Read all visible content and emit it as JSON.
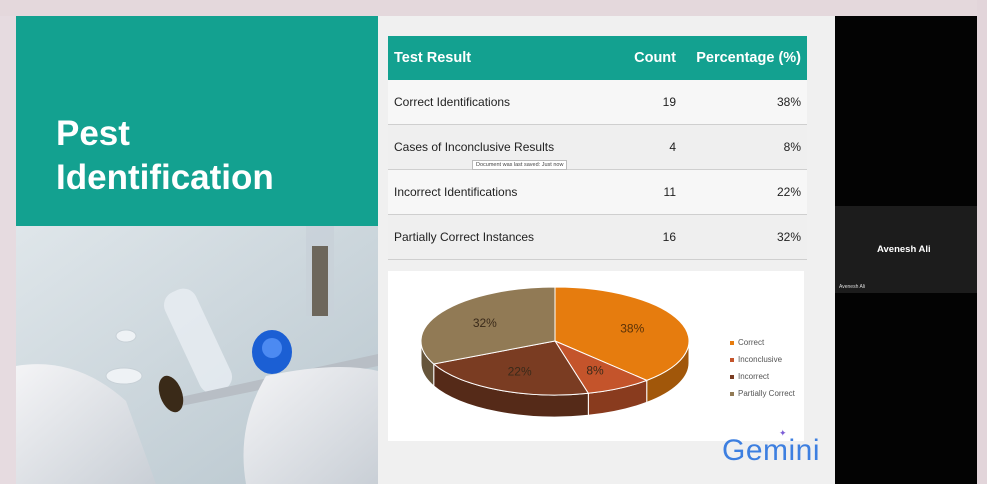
{
  "slide": {
    "title": "Pest Identification",
    "table": {
      "headers": [
        "Test Result",
        "Count",
        "Percentage (%)"
      ],
      "rows": [
        {
          "label": "Correct Identifications",
          "count": "19",
          "percent": "38%"
        },
        {
          "label": "Cases of Inconclusive Results",
          "count": "4",
          "percent": "8%"
        },
        {
          "label": "Incorrect Identifications",
          "count": "11",
          "percent": "22%"
        },
        {
          "label": "Partially Correct Instances",
          "count": "16",
          "percent": "32%"
        }
      ]
    },
    "tooltip": "Document was last saved: Just now",
    "pie": {
      "labels": [
        "38%",
        "8%",
        "22%",
        "32%"
      ],
      "legend": [
        "Correct",
        "Inconclusive",
        "Incorrect",
        "Partially Correct"
      ],
      "colors": [
        "#e67c0e",
        "#c4542b",
        "#7a3c22",
        "#917a55"
      ]
    },
    "watermark": "Gemini"
  },
  "call": {
    "tile_name": "Avenesh Ali",
    "tile_label": "Avenesh Ali"
  },
  "chart_data": {
    "type": "pie",
    "categories": [
      "Correct",
      "Inconclusive",
      "Incorrect",
      "Partially Correct"
    ],
    "values": [
      38,
      8,
      22,
      32
    ]
  }
}
